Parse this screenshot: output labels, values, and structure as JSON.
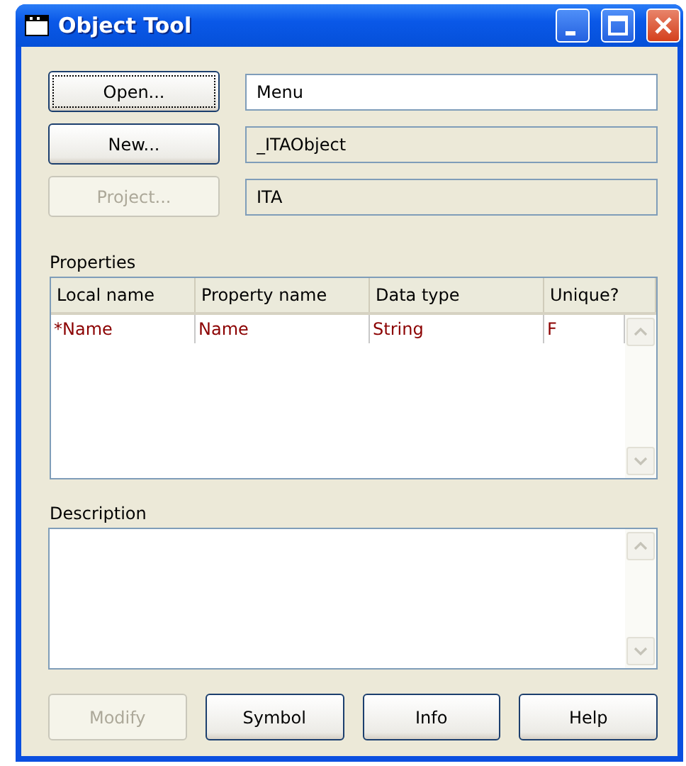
{
  "window": {
    "title": "Object Tool"
  },
  "object_rows": [
    {
      "button": {
        "label": "Open...",
        "disabled": false,
        "focused": true
      },
      "field": {
        "value": "Menu",
        "editable": true
      }
    },
    {
      "button": {
        "label": "New...",
        "disabled": false,
        "focused": false
      },
      "field": {
        "value": "_ITAObject",
        "editable": false
      }
    },
    {
      "button": {
        "label": "Project...",
        "disabled": true,
        "focused": false
      },
      "field": {
        "value": "ITA",
        "editable": false
      }
    }
  ],
  "properties": {
    "label": "Properties",
    "columns": [
      "Local name",
      "Property name",
      "Data type",
      "Unique?"
    ],
    "rows": [
      [
        "*Name",
        "Name",
        "String",
        "F"
      ]
    ]
  },
  "description": {
    "label": "Description"
  },
  "buttons": [
    {
      "label": "Modify",
      "disabled": true
    },
    {
      "label": "Symbol",
      "disabled": false
    },
    {
      "label": "Info",
      "disabled": false
    },
    {
      "label": "Help",
      "disabled": false
    }
  ]
}
